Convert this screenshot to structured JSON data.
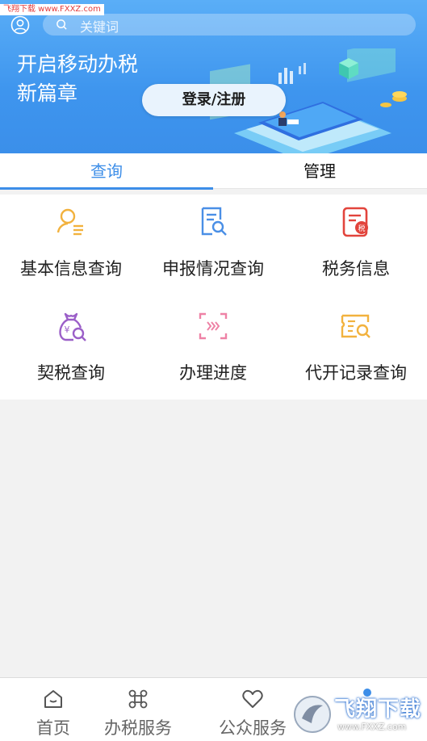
{
  "watermark_top": "飞翔下载 www.FXXZ.com",
  "search": {
    "placeholder": "关键词"
  },
  "banner": {
    "slogan_line1": "开启移动办税",
    "slogan_line2": "新篇章",
    "login_label": "登录/注册"
  },
  "tabs": [
    {
      "label": "查询",
      "active": true
    },
    {
      "label": "管理",
      "active": false
    }
  ],
  "grid": [
    {
      "label": "基本信息查询",
      "icon": "person-info-icon",
      "color": "#f2b23e"
    },
    {
      "label": "申报情况查询",
      "icon": "document-search-icon",
      "color": "#4a8fe6"
    },
    {
      "label": "税务信息",
      "icon": "tax-document-icon",
      "color": "#e2443c"
    },
    {
      "label": "契税查询",
      "icon": "money-bag-search-icon",
      "color": "#9b5fc8"
    },
    {
      "label": "办理进度",
      "icon": "progress-scan-icon",
      "color": "#ee82a6"
    },
    {
      "label": "代开记录查询",
      "icon": "ticket-search-icon",
      "color": "#f2b23e"
    }
  ],
  "bottom_nav": [
    {
      "label": "首页",
      "icon": "home-icon"
    },
    {
      "label": "办税服务",
      "icon": "grid-command-icon"
    },
    {
      "label": "公众服务",
      "icon": "heart-icon"
    }
  ],
  "watermark_bottom": {
    "brand": "飞翔下载",
    "url": "www.FXXZ.com"
  },
  "colors": {
    "accent": "#3d8ee8",
    "banner": "#4a9ff2"
  }
}
